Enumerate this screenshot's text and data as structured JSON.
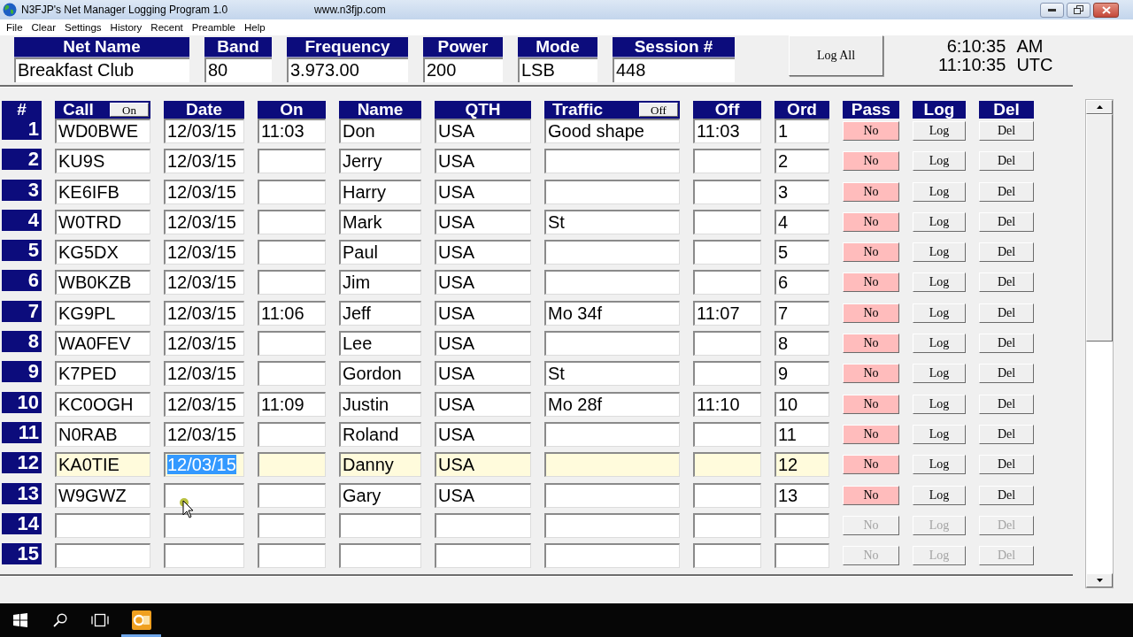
{
  "window": {
    "title": "N3FJP's Net Manager Logging Program 1.0",
    "url": "www.n3fjp.com"
  },
  "menu": [
    "File",
    "Clear",
    "Settings",
    "History",
    "Recent",
    "Preamble",
    "Help"
  ],
  "net_fields": [
    {
      "label": "Net Name",
      "value": "Breakfast Club"
    },
    {
      "label": "Band",
      "value": "80"
    },
    {
      "label": "Frequency",
      "value": "3.973.00"
    },
    {
      "label": "Power",
      "value": "200"
    },
    {
      "label": "Mode",
      "value": "LSB"
    },
    {
      "label": "Session #",
      "value": "448"
    }
  ],
  "log_all_button": "Log All",
  "clock": [
    {
      "time": "6:10:35",
      "suffix": "AM"
    },
    {
      "time": "11:10:35",
      "suffix": "UTC"
    }
  ],
  "table": {
    "columns": [
      {
        "label": "#"
      },
      {
        "label": "Call",
        "toggle": "On"
      },
      {
        "label": "Date"
      },
      {
        "label": "On"
      },
      {
        "label": "Name"
      },
      {
        "label": "QTH"
      },
      {
        "label": "Traffic",
        "toggle": "Off"
      },
      {
        "label": "Off"
      },
      {
        "label": "Ord"
      },
      {
        "label": "Pass"
      },
      {
        "label": "Log"
      },
      {
        "label": "Del"
      }
    ],
    "rows": [
      {
        "number": "1",
        "call": "WD0BWE",
        "date": "12/03/15",
        "on": "11:03",
        "name": "Don",
        "qth": "USA",
        "traffic": "Good shape",
        "off": "11:03",
        "ord": "1",
        "pass": "No",
        "log": "Log",
        "del": "Del",
        "selected": false,
        "date_text_selected": false,
        "disabled": false
      },
      {
        "number": "2",
        "call": "KU9S",
        "date": "12/03/15",
        "name": "Jerry",
        "qth": "USA",
        "ord": "2",
        "pass": "No",
        "log": "Log",
        "del": "Del",
        "selected": false,
        "date_text_selected": false,
        "disabled": false
      },
      {
        "number": "3",
        "call": "KE6IFB",
        "date": "12/03/15",
        "name": "Harry",
        "qth": "USA",
        "ord": "3",
        "pass": "No",
        "log": "Log",
        "del": "Del",
        "selected": false,
        "date_text_selected": false,
        "disabled": false
      },
      {
        "number": "4",
        "call": "W0TRD",
        "date": "12/03/15",
        "name": "Mark",
        "qth": "USA",
        "traffic": "St",
        "ord": "4",
        "pass": "No",
        "log": "Log",
        "del": "Del",
        "selected": false,
        "date_text_selected": false,
        "disabled": false
      },
      {
        "number": "5",
        "call": "KG5DX",
        "date": "12/03/15",
        "name": "Paul",
        "qth": "USA",
        "ord": "5",
        "pass": "No",
        "log": "Log",
        "del": "Del",
        "selected": false,
        "date_text_selected": false,
        "disabled": false
      },
      {
        "number": "6",
        "call": "WB0KZB",
        "date": "12/03/15",
        "name": "Jim",
        "qth": "USA",
        "ord": "6",
        "pass": "No",
        "log": "Log",
        "del": "Del",
        "selected": false,
        "date_text_selected": false,
        "disabled": false
      },
      {
        "number": "7",
        "call": "KG9PL",
        "date": "12/03/15",
        "on": "11:06",
        "name": "Jeff",
        "qth": "USA",
        "traffic": "Mo 34f",
        "off": "11:07",
        "ord": "7",
        "pass": "No",
        "log": "Log",
        "del": "Del",
        "selected": false,
        "date_text_selected": false,
        "disabled": false
      },
      {
        "number": "8",
        "call": "WA0FEV",
        "date": "12/03/15",
        "name": "Lee",
        "qth": "USA",
        "ord": "8",
        "pass": "No",
        "log": "Log",
        "del": "Del",
        "selected": false,
        "date_text_selected": false,
        "disabled": false
      },
      {
        "number": "9",
        "call": "K7PED",
        "date": "12/03/15",
        "name": "Gordon",
        "qth": "USA",
        "traffic": "St",
        "ord": "9",
        "pass": "No",
        "log": "Log",
        "del": "Del",
        "selected": false,
        "date_text_selected": false,
        "disabled": false
      },
      {
        "number": "10",
        "call": "KC0OGH",
        "date": "12/03/15",
        "on": "11:09",
        "name": "Justin",
        "qth": "USA",
        "traffic": "Mo 28f",
        "off": "11:10",
        "ord": "10",
        "pass": "No",
        "log": "Log",
        "del": "Del",
        "selected": false,
        "date_text_selected": false,
        "disabled": false
      },
      {
        "number": "11",
        "call": "N0RAB",
        "date": "12/03/15",
        "name": "Roland",
        "qth": "USA",
        "ord": "11",
        "pass": "No",
        "log": "Log",
        "del": "Del",
        "selected": false,
        "date_text_selected": false,
        "disabled": false
      },
      {
        "number": "12",
        "call": "KA0TIE",
        "date": "12/03/15",
        "name": "Danny",
        "qth": "USA",
        "ord": "12",
        "pass": "No",
        "log": "Log",
        "del": "Del",
        "selected": true,
        "date_text_selected": true,
        "disabled": false
      },
      {
        "number": "13",
        "call": "W9GWZ",
        "name": "Gary",
        "qth": "USA",
        "ord": "13",
        "pass": "No",
        "log": "Log",
        "del": "Del",
        "selected": false,
        "date_text_selected": false,
        "disabled": false
      },
      {
        "number": "14",
        "pass": "No",
        "log": "Log",
        "del": "Del",
        "selected": false,
        "date_text_selected": false,
        "disabled": true
      },
      {
        "number": "15",
        "pass": "No",
        "log": "Log",
        "del": "Del",
        "selected": false,
        "date_text_selected": false,
        "disabled": true
      }
    ]
  }
}
